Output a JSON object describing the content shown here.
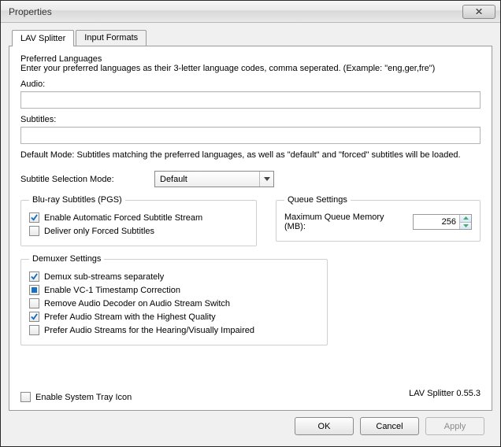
{
  "window": {
    "title": "Properties"
  },
  "tabs": {
    "splitter": "LAV Splitter",
    "input": "Input Formats"
  },
  "pref": {
    "heading": "Preferred Languages",
    "hint": "Enter your preferred languages as their 3-letter language codes, comma seperated. (Example: \"eng,ger,fre\")",
    "audio_label": "Audio:",
    "audio_value": "",
    "subs_label": "Subtitles:",
    "subs_value": "",
    "default_mode": "Default Mode: Subtitles matching the preferred languages, as well as \"default\" and \"forced\" subtitles will be loaded."
  },
  "subtitle_mode": {
    "label": "Subtitle Selection Mode:",
    "value": "Default"
  },
  "pgs": {
    "legend": "Blu-ray Subtitles (PGS)",
    "auto_forced": "Enable Automatic Forced Subtitle Stream",
    "only_forced": "Deliver only Forced Subtitles"
  },
  "queue": {
    "legend": "Queue Settings",
    "max_label": "Maximum Queue Memory (MB):",
    "max_value": "256"
  },
  "demux": {
    "legend": "Demuxer Settings",
    "sub_streams": "Demux sub-streams separately",
    "vc1": "Enable VC-1 Timestamp Correction",
    "remove_dec": "Remove Audio Decoder on Audio Stream Switch",
    "prefer_hq": "Prefer Audio Stream with the Highest Quality",
    "prefer_hi": "Prefer Audio Streams for the Hearing/Visually Impaired"
  },
  "tray": {
    "label": "Enable System Tray Icon"
  },
  "version": "LAV Splitter 0.55.3",
  "buttons": {
    "ok": "OK",
    "cancel": "Cancel",
    "apply": "Apply"
  }
}
